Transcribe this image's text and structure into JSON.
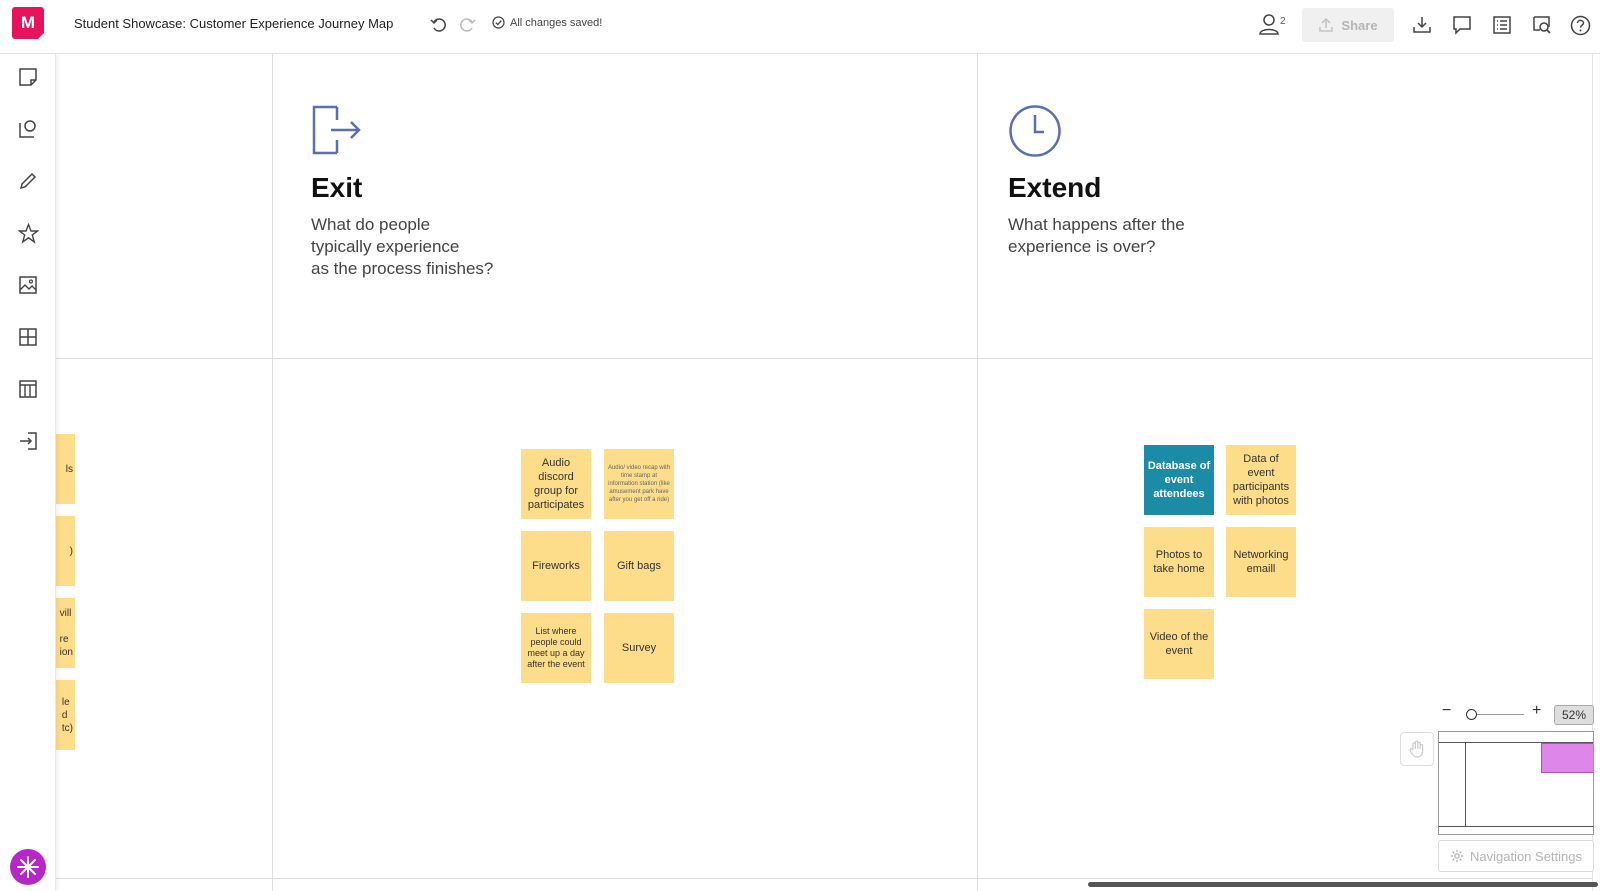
{
  "app": {
    "logo_letter": "M",
    "doc_title": "Student Showcase: Customer Experience Journey Map",
    "save_status": "All changes saved!",
    "collaborator_count": "2",
    "share_label": "Share",
    "accent_color": "#e8135d"
  },
  "sidebar": {
    "tools": [
      {
        "name": "sticky-note-icon"
      },
      {
        "name": "comment-shape-icon"
      },
      {
        "name": "pen-icon"
      },
      {
        "name": "star-icon"
      },
      {
        "name": "image-icon"
      },
      {
        "name": "grid-icon"
      },
      {
        "name": "table-icon"
      },
      {
        "name": "import-icon"
      }
    ]
  },
  "sections": {
    "exit": {
      "title": "Exit",
      "description": "What do people\ntypically experience\nas the process finishes?"
    },
    "extend": {
      "title": "Extend",
      "description": "What happens after the\nexperience is over?"
    }
  },
  "left_clipped_notes": [
    "ls",
    ")",
    "vill\n\nre\nion",
    "le\nd\ntc)"
  ],
  "exit_notes": [
    "Audio discord group for participates",
    "Audio/ video recap with time stamp at information station (like amusement park have after you get off a ride)",
    "Fireworks",
    "Gift bags",
    "List where people could meet up a day after the event",
    "Survey"
  ],
  "extend_notes": [
    "Database of event attendees",
    "Data of event participants with photos",
    "Photos to take home",
    "Networking emaill",
    "Video of the event"
  ],
  "colors": {
    "sticky_yellow": "#fddc8a",
    "sticky_teal": "#1b8ba6",
    "minimap_viewport": "#df86ea"
  },
  "zoom": {
    "minus": "−",
    "plus": "+",
    "percent": "52%",
    "level": 0.52
  },
  "nav_settings_label": "Navigation Settings"
}
